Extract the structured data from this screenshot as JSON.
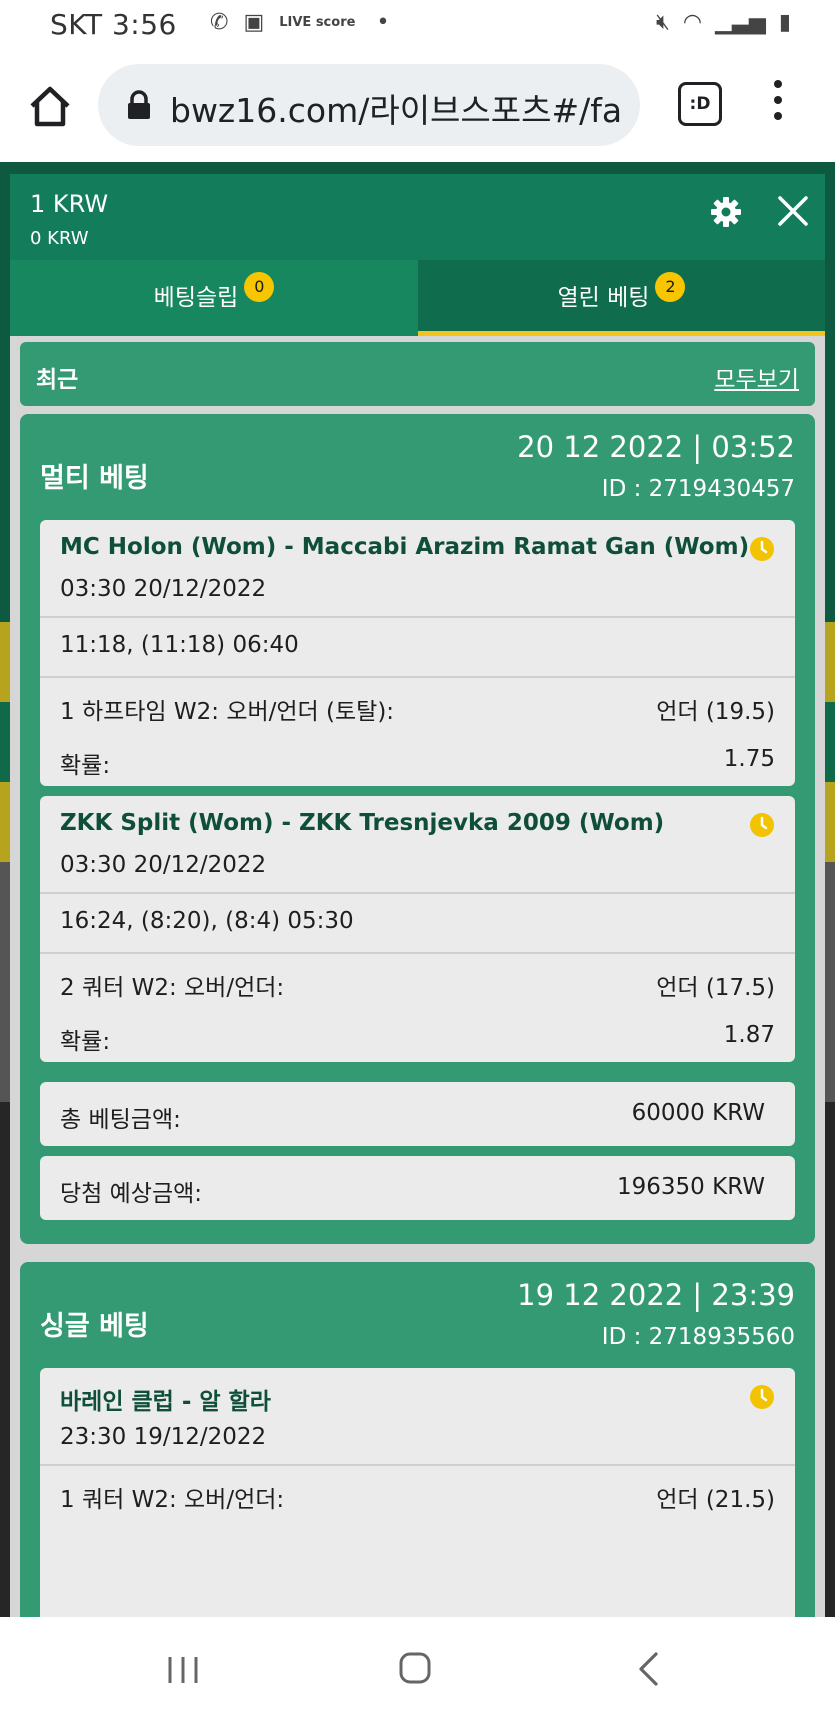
{
  "status_bar": {
    "carrier_time": "SKT 3:56",
    "live_score_icon_text": "LIVE score",
    "icons_left": [
      "vibrate-icon",
      "image-icon",
      "live-score-icon",
      "dot-icon"
    ],
    "icons_right": [
      "mute-icon",
      "wifi-icon",
      "signal-icon",
      "battery-icon"
    ]
  },
  "browser": {
    "url": "bwz16.com/라이브스포츠#/fa",
    "tab_button_label": ":D"
  },
  "panel": {
    "balance_main": "1 KRW",
    "balance_sub": "0 KRW",
    "tabs": [
      {
        "label": "베팅슬립",
        "badge": "0"
      },
      {
        "label": "열린 베팅",
        "badge": "2"
      }
    ],
    "recent_label": "최근",
    "view_all": "모두보기"
  },
  "bets": [
    {
      "type": "멀티 베팅",
      "datetime": "20 12 2022 | 03:52",
      "id": "ID :  2719430457",
      "events": [
        {
          "title": "MC Holon (Wom) - Maccabi Arazim Ramat Gan (Wom)",
          "when": "03:30   20/12/2022",
          "score": "11:18, (11:18) 06:40",
          "market": "1 하프타임 W2: 오버/언더 (토탈):",
          "pick": "언더 (19.5)",
          "odds_label": "확률:",
          "odds": "1.75"
        },
        {
          "title": "ZKK Split (Wom) - ZKK Tresnjevka 2009 (Wom)",
          "when": "03:30   20/12/2022",
          "score": "16:24, (8:20), (8:4) 05:30",
          "market": "2 쿼터 W2: 오버/언더:",
          "pick": "언더 (17.5)",
          "odds_label": "확률:",
          "odds": "1.87"
        }
      ],
      "stake_label": "총 베팅금액:",
      "stake": "60000 KRW",
      "payout_label": "당첨 예상금액:",
      "payout": "196350 KRW"
    },
    {
      "type": "싱글 베팅",
      "datetime": "19 12 2022 | 23:39",
      "id": "ID :  2718935560",
      "events": [
        {
          "title": "바레인 클럽 - 알 할라",
          "when": "23:30   19/12/2022",
          "market": "1 쿼터 W2: 오버/언더:",
          "pick": "언더 (21.5)"
        }
      ]
    }
  ],
  "colors": {
    "header_green": "#137d5b",
    "card_green": "#349a73",
    "accent_yellow": "#f3c41b"
  }
}
